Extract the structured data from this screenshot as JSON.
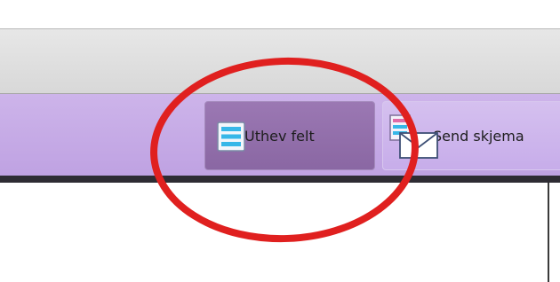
{
  "toolbar": {
    "highlight_fields": {
      "label": "Uthev felt",
      "icon": "form-fields-icon"
    },
    "send_form": {
      "label": "Send skjema",
      "icon": "send-form-icon"
    }
  },
  "colors": {
    "toolbar_purple": "#c7adea",
    "active_button": "#8a67a3",
    "annotation_red": "#e0201f"
  }
}
